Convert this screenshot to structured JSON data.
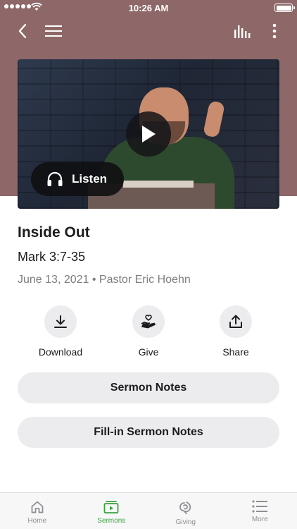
{
  "status_bar": {
    "time": "10:26 AM"
  },
  "sermon": {
    "title": "Inside Out",
    "scripture": "Mark 3:7-35",
    "meta": "June 13, 2021 • Pastor Eric Hoehn"
  },
  "media": {
    "listen_label": "Listen"
  },
  "actions": {
    "download_label": "Download",
    "give_label": "Give",
    "share_label": "Share"
  },
  "buttons": {
    "sermon_notes": "Sermon Notes",
    "fill_in_notes": "Fill-in Sermon Notes"
  },
  "tabs": [
    {
      "label": "Home",
      "icon": "home-icon"
    },
    {
      "label": "Sermons",
      "icon": "video-icon"
    },
    {
      "label": "Giving",
      "icon": "giving-icon"
    },
    {
      "label": "More",
      "icon": "list-icon"
    }
  ],
  "colors": {
    "header_band": "#8e6868",
    "accent": "#3aa13f"
  }
}
